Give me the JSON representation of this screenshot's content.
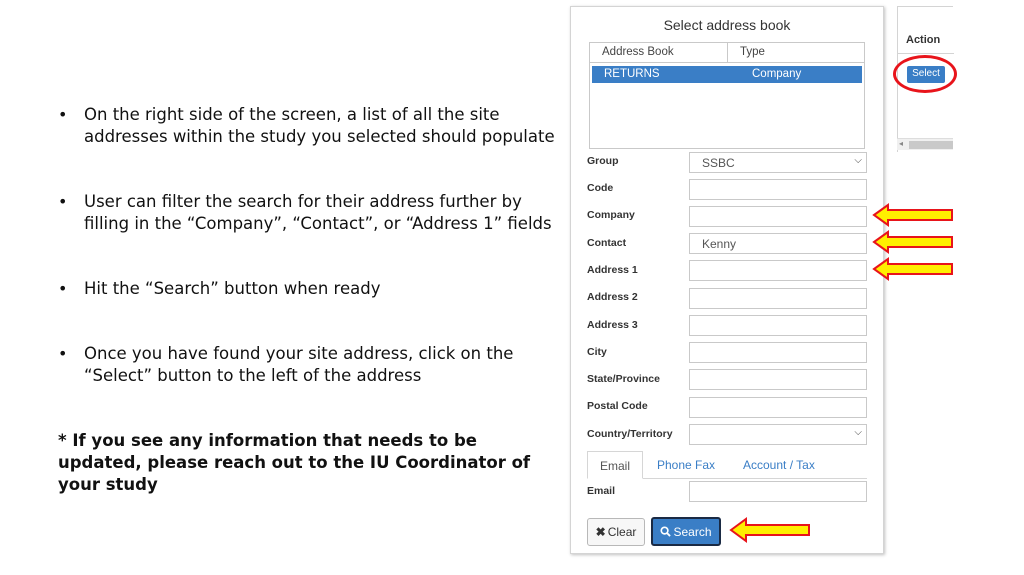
{
  "slide": {
    "bullets": [
      "On the right side of the screen, a list of all the site addresses within the study you selected should populate",
      "User can filter the search for their address further by filling in the “Company”, “Contact”, or “Address 1” fields",
      "Hit the “Search” button when ready",
      "Once you have found your site address, click on the “Select” button to the left of the address"
    ],
    "note": "* If you see any information that needs to be updated, please reach out to the IU Coordinator of your study"
  },
  "dialog": {
    "title": "Select address book",
    "list": {
      "headers": [
        "Address Book",
        "Type"
      ],
      "rows": [
        {
          "address_book": "RETURNS",
          "type": "Company"
        }
      ]
    },
    "fields": {
      "group": {
        "label": "Group",
        "value": "SSBC"
      },
      "code": {
        "label": "Code",
        "value": ""
      },
      "company": {
        "label": "Company",
        "value": ""
      },
      "contact": {
        "label": "Contact",
        "value": "Kenny"
      },
      "address1": {
        "label": "Address 1",
        "value": ""
      },
      "address2": {
        "label": "Address 2",
        "value": ""
      },
      "address3": {
        "label": "Address 3",
        "value": ""
      },
      "city": {
        "label": "City",
        "value": ""
      },
      "state": {
        "label": "State/Province",
        "value": ""
      },
      "postal": {
        "label": "Postal Code",
        "value": ""
      },
      "country": {
        "label": "Country/Territory",
        "value": ""
      },
      "email": {
        "label": "Email",
        "value": ""
      }
    },
    "tabs": [
      "Email",
      "Phone Fax",
      "Account / Tax"
    ],
    "buttons": {
      "clear": "Clear",
      "search": "Search"
    }
  },
  "action_panel": {
    "title": "Action",
    "select_label": "Select"
  },
  "colors": {
    "accent": "#3a7ec6",
    "arrow_fill": "#ffef00",
    "arrow_stroke": "#e8141b",
    "ring": "#e8141b"
  }
}
